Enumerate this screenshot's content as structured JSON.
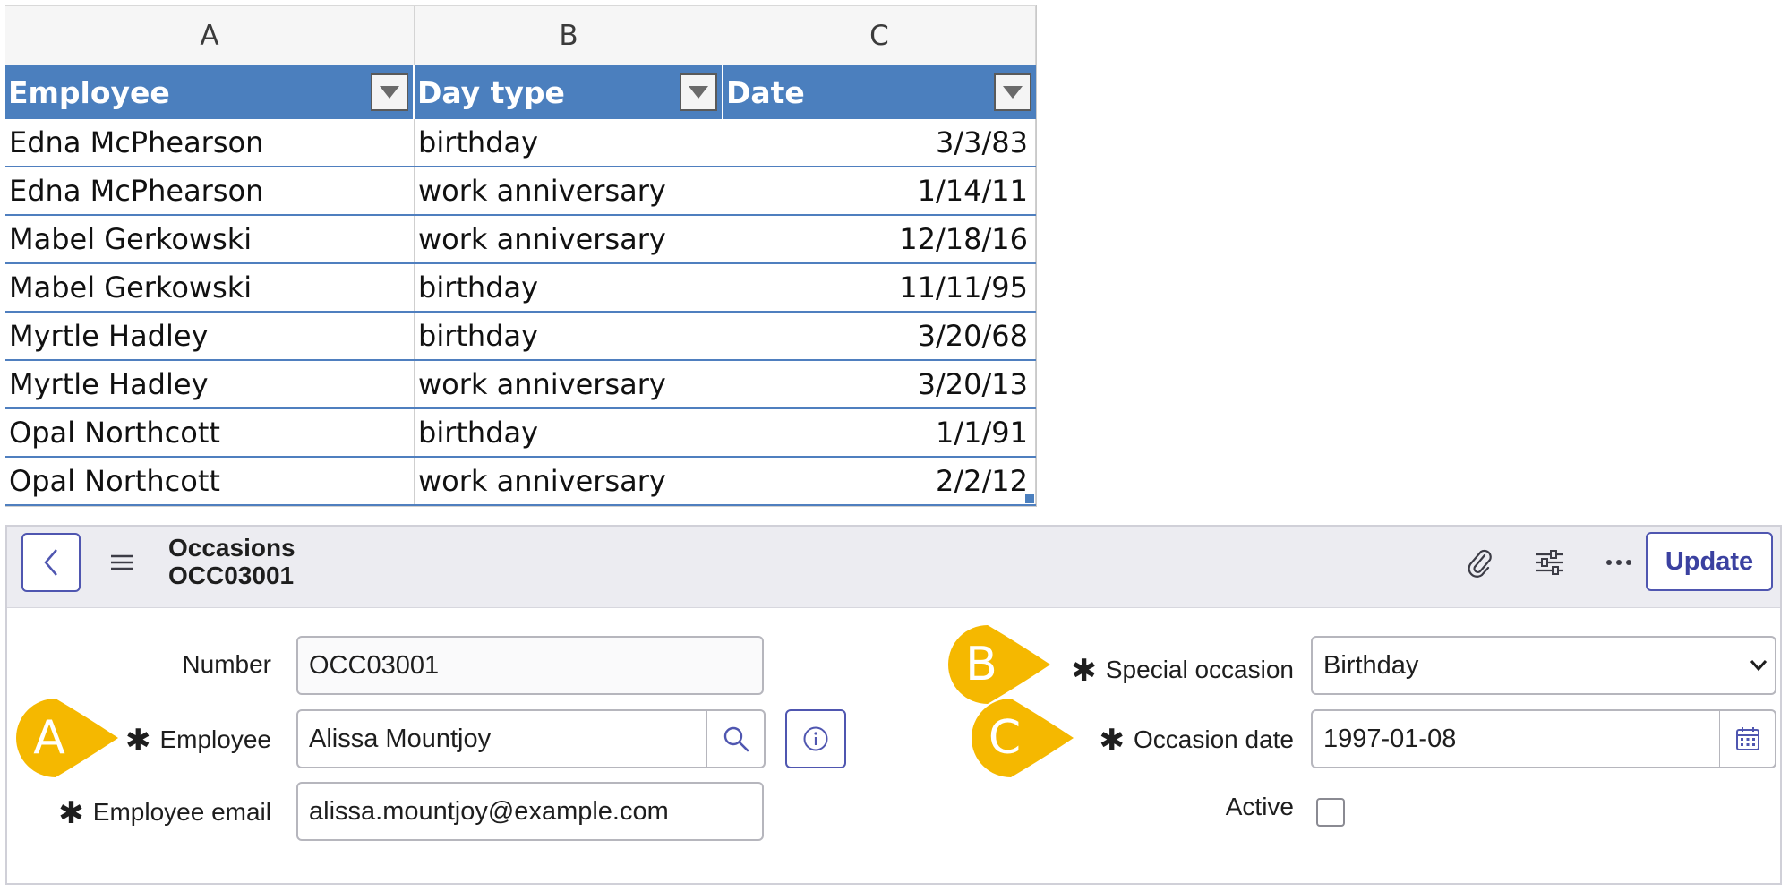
{
  "spreadsheet": {
    "column_letters": [
      "A",
      "B",
      "C"
    ],
    "headers": [
      "Employee",
      "Day type",
      "Date"
    ],
    "rows": [
      [
        "Edna McPhearson",
        "birthday",
        "3/3/83"
      ],
      [
        "Edna McPhearson",
        "work anniversary",
        "1/14/11"
      ],
      [
        "Mabel Gerkowski",
        "work anniversary",
        "12/18/16"
      ],
      [
        "Mabel Gerkowski",
        "birthday",
        "11/11/95"
      ],
      [
        "Myrtle Hadley",
        "birthday",
        "3/20/68"
      ],
      [
        "Myrtle Hadley",
        "work anniversary",
        "3/20/13"
      ],
      [
        "Opal Northcott",
        "birthday",
        "1/1/91"
      ],
      [
        "Opal Northcott",
        "work anniversary",
        "2/2/12"
      ]
    ],
    "header_color": "#4b7fbe"
  },
  "form": {
    "header": {
      "table_name": "Occasions",
      "record_number": "OCC03001",
      "update_label": "Update"
    },
    "fields": {
      "number": {
        "label": "Number",
        "value": "OCC03001"
      },
      "employee": {
        "label": "Employee",
        "value": "Alissa Mountjoy",
        "required": "✱"
      },
      "employee_email": {
        "label": "Employee email",
        "value": "alissa.mountjoy@example.com",
        "required": "✱"
      },
      "special_occasion": {
        "label": "Special occasion",
        "value": "Birthday",
        "required": "✱"
      },
      "occasion_date": {
        "label": "Occasion date",
        "value": "1997-01-08",
        "required": "✱"
      },
      "active": {
        "label": "Active",
        "checked": false
      }
    },
    "accent_color": "#4f56b0"
  },
  "callouts": {
    "a": "A",
    "b": "B",
    "c": "C",
    "color": "#f5b800"
  }
}
